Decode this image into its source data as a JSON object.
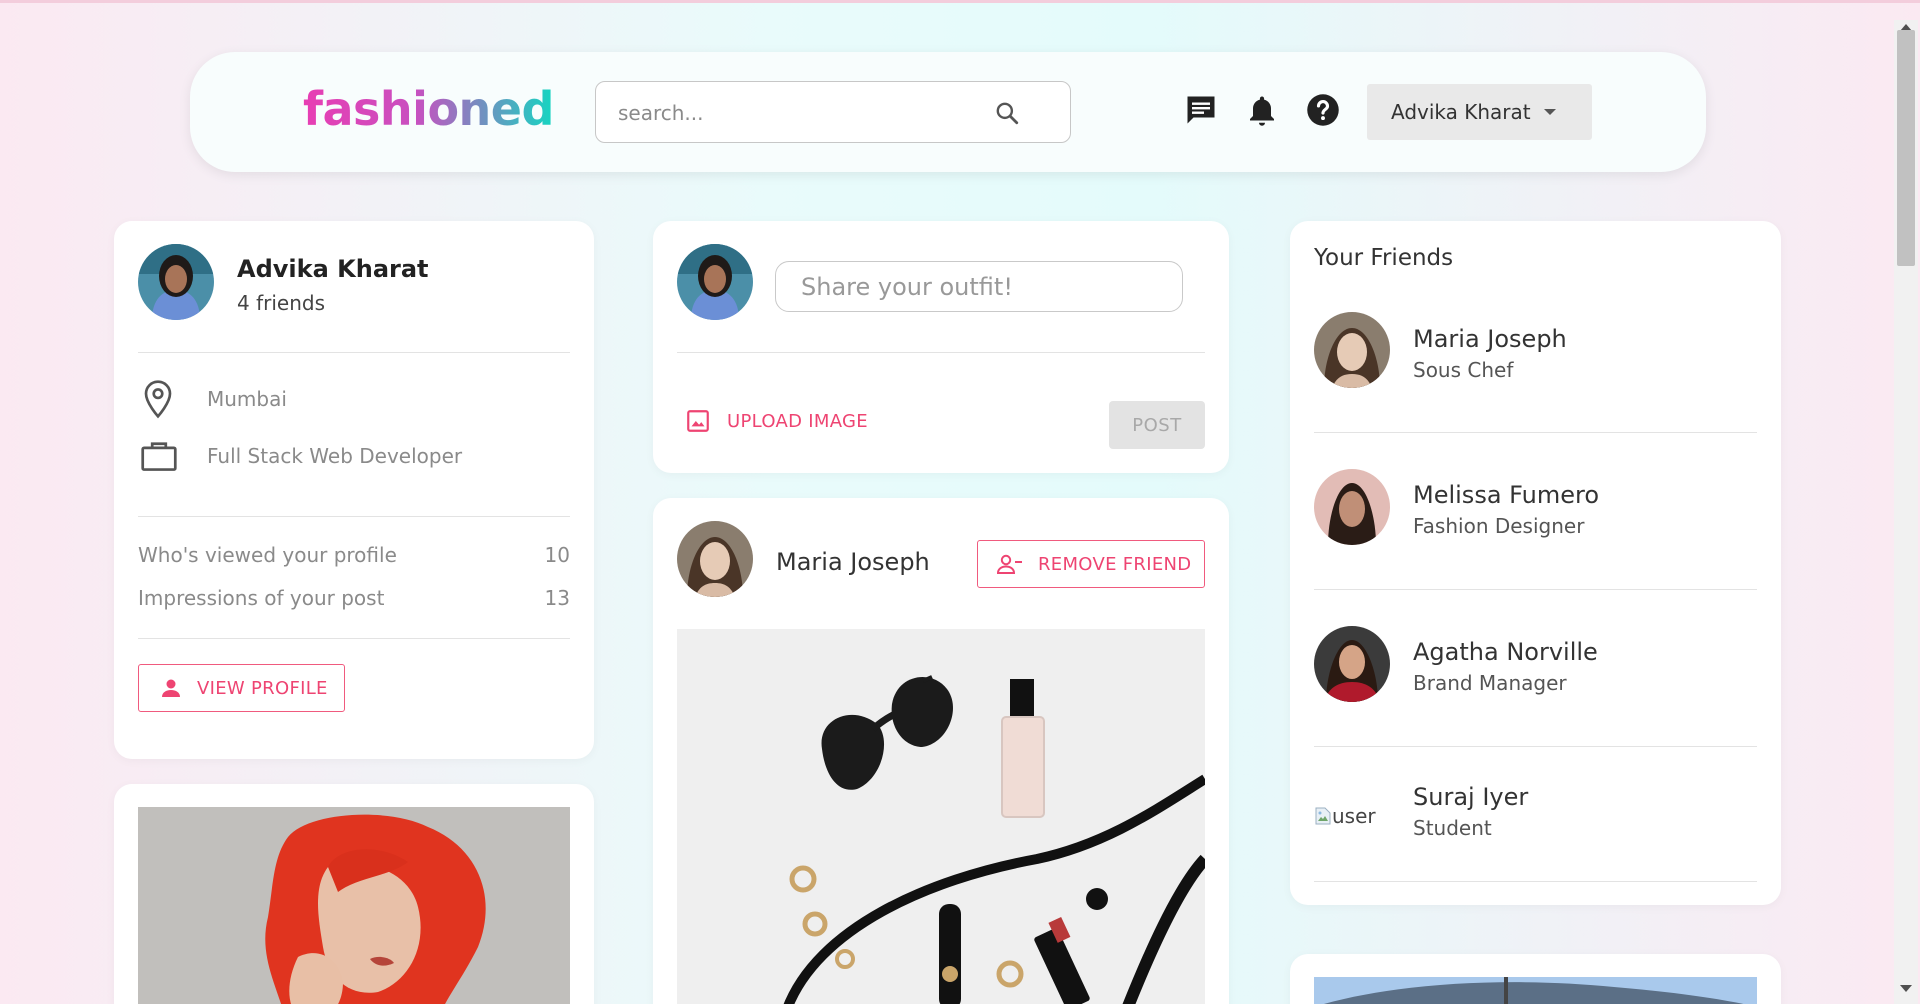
{
  "navbar": {
    "logo": "fashioned",
    "search_placeholder": "search...",
    "icons": [
      "message-icon",
      "bell-icon",
      "help-icon",
      "search-icon"
    ],
    "user_menu_label": "Advika Kharat"
  },
  "profile_card": {
    "name": "Advika Kharat",
    "friends_count": "4 friends",
    "location": "Mumbai",
    "occupation": "Full Stack Web Developer",
    "stats": [
      {
        "label": "Who's viewed your profile",
        "value": "10"
      },
      {
        "label": "Impressions of your post",
        "value": "13"
      }
    ],
    "view_profile_label": "VIEW PROFILE"
  },
  "composer": {
    "placeholder": "Share your outfit!",
    "upload_label": "UPLOAD IMAGE",
    "post_label": "POST"
  },
  "feed_post": {
    "author": "Maria Joseph",
    "remove_friend_label": "REMOVE FRIEND"
  },
  "friends_card": {
    "title": "Your Friends",
    "friends": [
      {
        "name": "Maria Joseph",
        "role": "Sous Chef"
      },
      {
        "name": "Melissa Fumero",
        "role": "Fashion Designer"
      },
      {
        "name": "Agatha Norville",
        "role": "Brand Manager"
      },
      {
        "name": "Suraj Iyer",
        "role": "Student",
        "broken_image_alt": "user"
      }
    ]
  },
  "colors": {
    "accent": "#ee4472",
    "logo_pink": "#e83eb3",
    "logo_teal": "#14d6c1"
  }
}
